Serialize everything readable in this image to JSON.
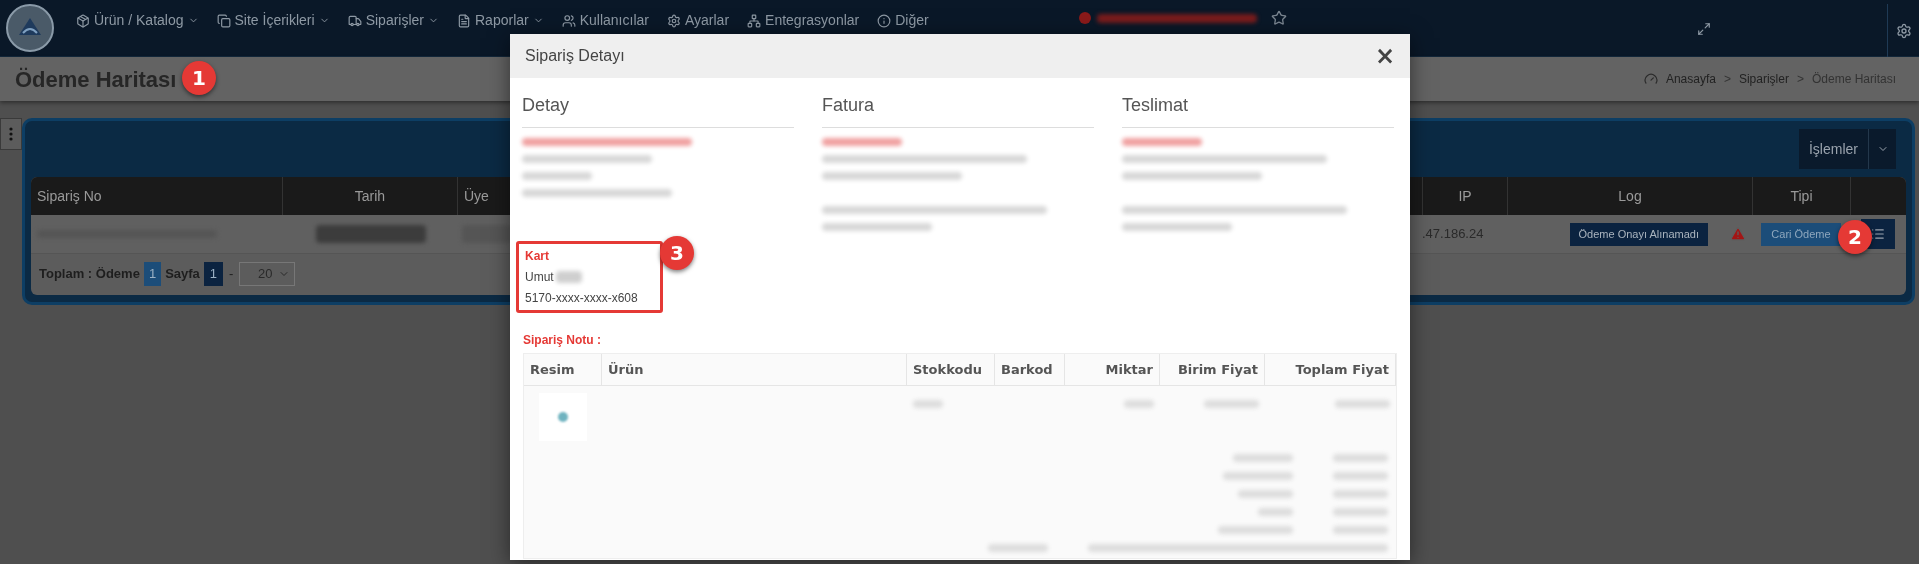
{
  "nav": {
    "items": [
      {
        "label": "Ürün / Katalog",
        "caret": true
      },
      {
        "label": "Site İçerikleri",
        "caret": true
      },
      {
        "label": "Siparişler",
        "caret": true
      },
      {
        "label": "Raporlar",
        "caret": true
      },
      {
        "label": "Kullanıcılar",
        "caret": false
      },
      {
        "label": "Ayarlar",
        "caret": false
      },
      {
        "label": "Entegrasyonlar",
        "caret": false
      },
      {
        "label": "Diğer",
        "caret": false
      }
    ]
  },
  "page_title": "Ödeme Haritası",
  "breadcrumb": {
    "separator": ">",
    "items": [
      "Anasayfa",
      "Siparişler",
      "Ödeme Haritası"
    ]
  },
  "panel": {
    "actions_button": "İşlemler",
    "table": {
      "columns_left": [
        "Sipariş No",
        "Tarih",
        "Üye"
      ],
      "columns_right": [
        "IP",
        "Log",
        "Tipi"
      ],
      "rows": [
        {
          "ip": ".47.186.24",
          "log": "Ödeme Onayı Alınamadı",
          "warning": true,
          "type": "Cari Ödeme"
        }
      ]
    },
    "footer": {
      "total_label": "Toplam : Ödeme",
      "total": "1",
      "page_label": "Sayfa",
      "page": "1",
      "separator": "-",
      "page_size": "20"
    }
  },
  "modal": {
    "title": "Sipariş Detayı",
    "close": "×",
    "sections": [
      {
        "heading": "Detay"
      },
      {
        "heading": "Fatura"
      },
      {
        "heading": "Teslimat"
      }
    ],
    "card": {
      "label": "Kart",
      "holder": "Umut",
      "number": "5170-xxxx-xxxx-x608"
    },
    "note_label": "Sipariş Notu :",
    "items_table": {
      "columns": [
        "Resim",
        "Ürün",
        "Stokkodu",
        "Barkod",
        "Miktar",
        "Birim Fiyat",
        "Toplam Fiyat"
      ]
    }
  },
  "annotations": [
    "1",
    "2",
    "3"
  ]
}
